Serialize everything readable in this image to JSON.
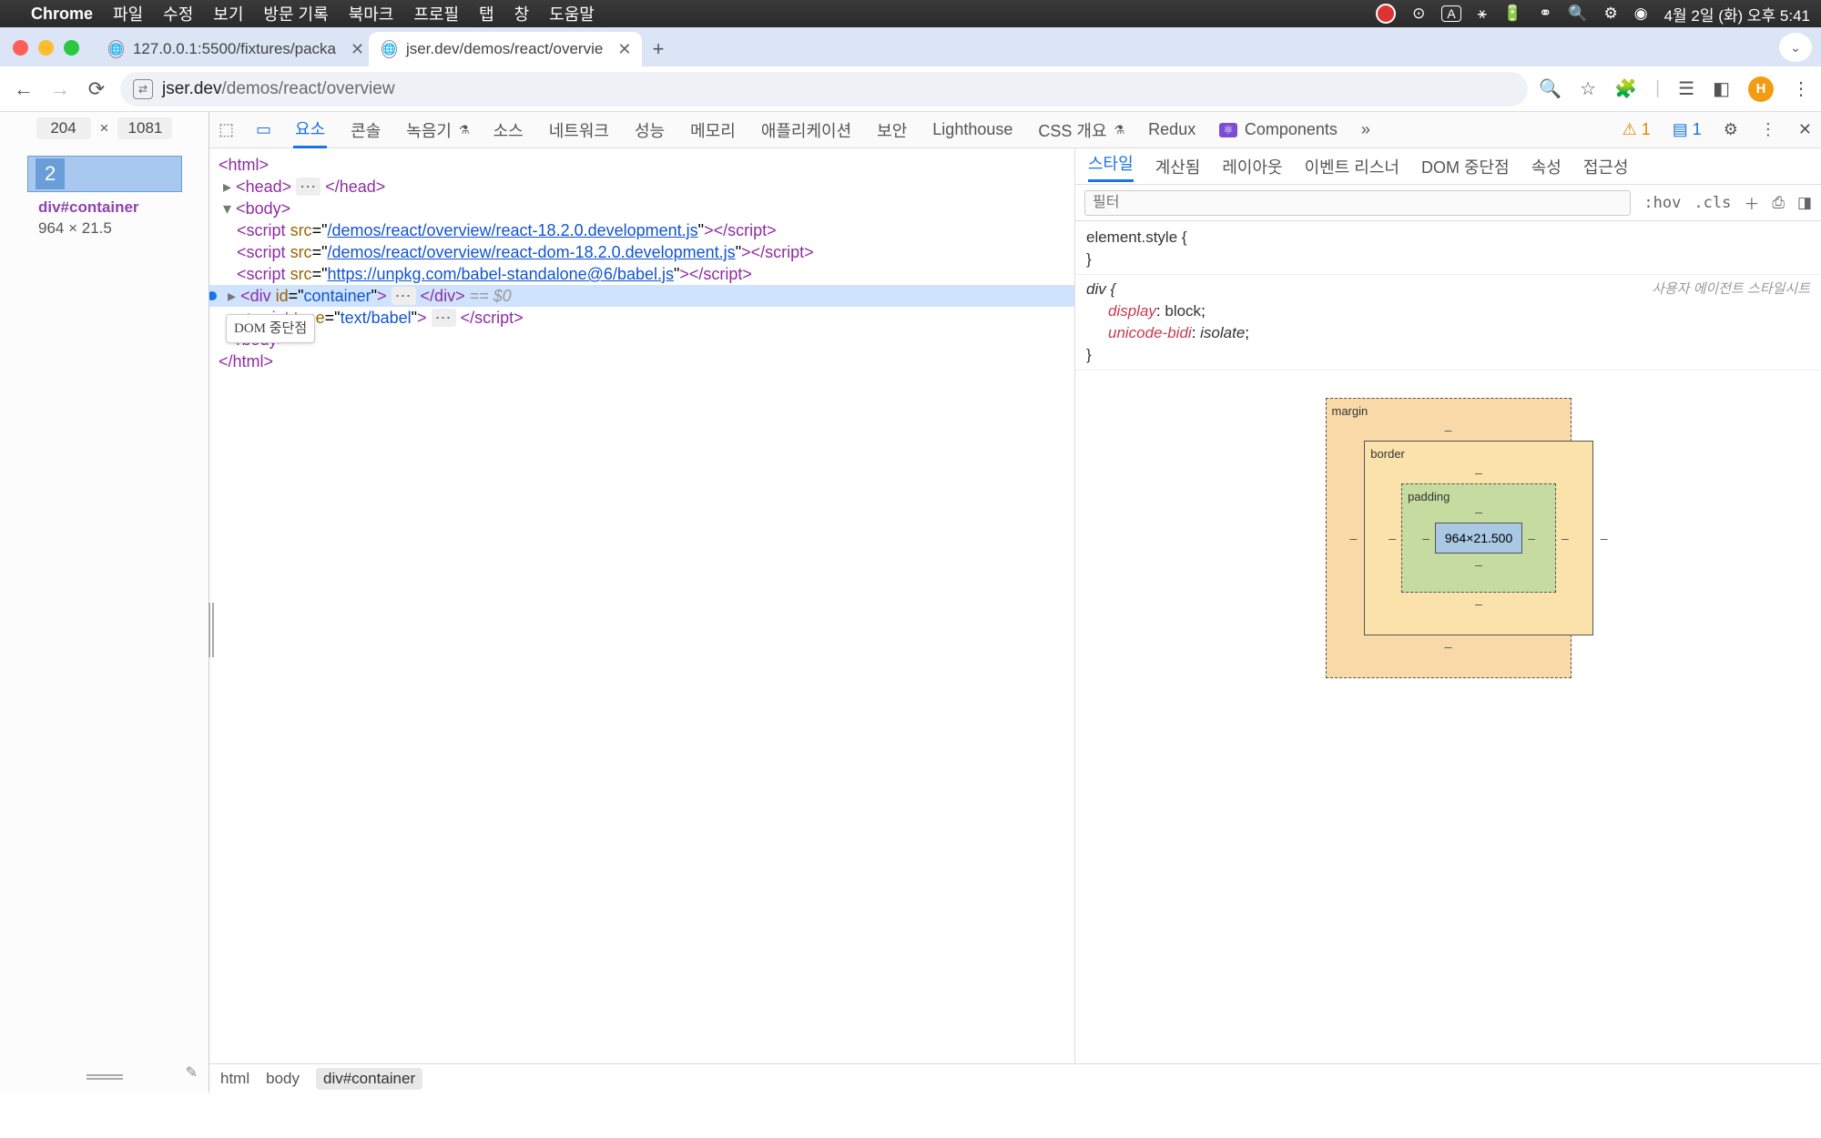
{
  "menubar": {
    "app": "Chrome",
    "items": [
      "파일",
      "수정",
      "보기",
      "방문 기록",
      "북마크",
      "프로필",
      "탭",
      "창",
      "도움말"
    ],
    "ime": "A",
    "datetime": "4월 2일 (화) 오후 5:41"
  },
  "browser": {
    "tabs": [
      {
        "title": "127.0.0.1:5500/fixtures/packa",
        "active": false
      },
      {
        "title": "jser.dev/demos/react/overvie",
        "active": true
      }
    ],
    "url_host": "jser.dev",
    "url_path": "/demos/react/overview",
    "avatar": "H"
  },
  "viewport": {
    "width": "204",
    "height": "1081",
    "highlight_text": "2",
    "tooltip_selector": "div#container",
    "tooltip_dim": "964 × 21.5"
  },
  "devtools": {
    "tabs": [
      "요소",
      "콘솔",
      "녹음기",
      "소스",
      "네트워크",
      "성능",
      "메모리",
      "애플리케이션",
      "보안",
      "Lighthouse",
      "CSS 개요",
      "Redux",
      "Components"
    ],
    "active_tab": "요소",
    "issues_warn": "1",
    "issues_msg": "1"
  },
  "dom": {
    "scripts": [
      "/demos/react/overview/react-18.2.0.development.js",
      "/demos/react/overview/react-dom-18.2.0.development.js",
      "https://unpkg.com/babel-standalone@6/babel.js"
    ],
    "container_id": "container",
    "babel_type": "text/babel",
    "sel_hint": "== $0",
    "tooltip": "DOM 중단점"
  },
  "styles_panel": {
    "tabs": [
      "스타일",
      "계산됨",
      "레이아웃",
      "이벤트 리스너",
      "DOM 중단점",
      "속성",
      "접근성"
    ],
    "active": "스타일",
    "filter_placeholder": "필터",
    "hov": ":hov",
    "cls": ".cls",
    "rules": {
      "element_style": "element.style {",
      "div_sel": "div {",
      "div_src": "사용자 에이전트 스타일시트",
      "p1_name": "display",
      "p1_val": "block",
      "p2_name": "unicode-bidi",
      "p2_val": "isolate",
      "close": "}"
    },
    "boxmodel": {
      "margin": "margin",
      "border": "border",
      "padding": "padding",
      "content": "964×21.500",
      "dash": "–"
    }
  },
  "crumbs": [
    "html",
    "body",
    "div#container"
  ]
}
